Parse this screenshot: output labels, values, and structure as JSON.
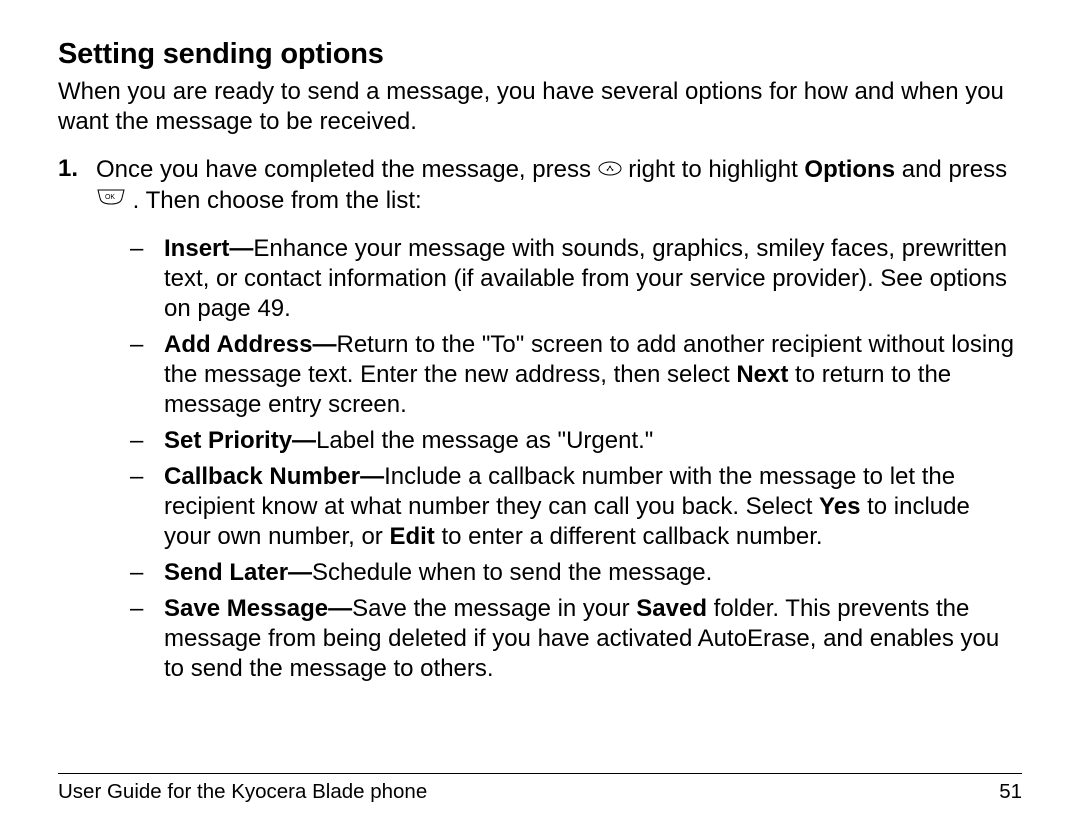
{
  "heading": "Setting sending options",
  "intro": "When you are ready to send a message, you have several options for how and when you want the message to be received.",
  "step": {
    "num": "1.",
    "pre_icon1": "Once you have completed the message, press ",
    "post_icon1": " right to highlight ",
    "options_word": "Options",
    "pre_icon2": " and press ",
    "post_icon2": " . Then choose from the list:"
  },
  "dash": "–",
  "items": [
    {
      "label": "Insert—",
      "body_parts": [
        {
          "text": "Enhance your message with sounds, graphics, smiley faces, prewritten text, or contact information (if available from your service provider). See options on page 49."
        }
      ]
    },
    {
      "label": "Add Address—",
      "body_parts": [
        {
          "text": "Return to the \"To\" screen to add another recipient without losing the message text. Enter the new address, then select "
        },
        {
          "text": "Next",
          "bold": true
        },
        {
          "text": " to return to the message entry screen."
        }
      ]
    },
    {
      "label": "Set Priority—",
      "body_parts": [
        {
          "text": "Label the message as \"Urgent.\""
        }
      ]
    },
    {
      "label": "Callback Number—",
      "body_parts": [
        {
          "text": "Include a callback number with the message to let the recipient know at what number they can call you back. Select "
        },
        {
          "text": "Yes",
          "bold": true
        },
        {
          "text": " to include your own number, or "
        },
        {
          "text": "Edit",
          "bold": true
        },
        {
          "text": " to enter a different callback number."
        }
      ]
    },
    {
      "label": "Send Later—",
      "body_parts": [
        {
          "text": "Schedule when to send the message."
        }
      ]
    },
    {
      "label": "Save Message—",
      "body_parts": [
        {
          "text": "Save the message in your "
        },
        {
          "text": "Saved",
          "bold": true
        },
        {
          "text": " folder. This prevents the message from being deleted if you have activated AutoErase, and enables you to send the message to others."
        }
      ]
    }
  ],
  "footer": {
    "title": "User Guide for the Kyocera Blade phone",
    "page": "51"
  }
}
